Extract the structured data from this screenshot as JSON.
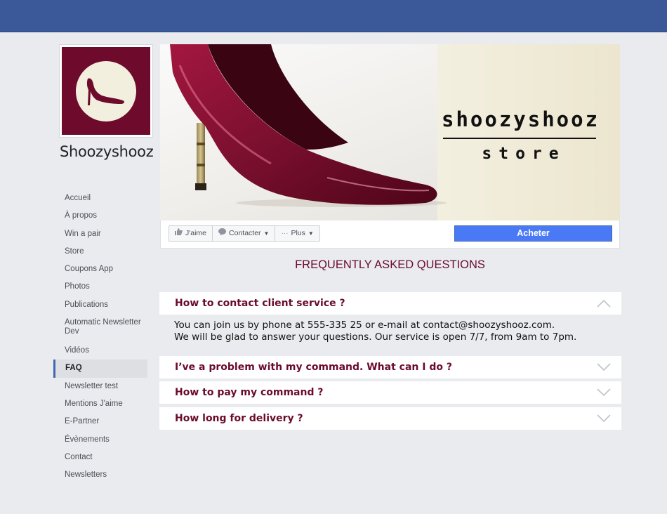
{
  "page": {
    "name": "Shoozyshooz"
  },
  "cover": {
    "brand_title": "shoozyshooz",
    "brand_subtitle": "store"
  },
  "actions": {
    "like": "J'aime",
    "contact": "Contacter",
    "more": "Plus",
    "buy": "Acheter"
  },
  "nav": {
    "items": [
      {
        "label": "Accueil"
      },
      {
        "label": "À propos"
      },
      {
        "label": "Win a pair"
      },
      {
        "label": "Store"
      },
      {
        "label": "Coupons App"
      },
      {
        "label": "Photos"
      },
      {
        "label": "Publications"
      },
      {
        "label": "Automatic Newsletter Dev"
      },
      {
        "label": "Vidéos"
      },
      {
        "label": "FAQ"
      },
      {
        "label": "Newsletter test"
      },
      {
        "label": "Mentions J'aime"
      },
      {
        "label": "E-Partner"
      },
      {
        "label": "Évènements"
      },
      {
        "label": "Contact"
      },
      {
        "label": "Newsletters"
      }
    ],
    "active": "FAQ"
  },
  "faq": {
    "title": "FREQUENTLY ASKED QUESTIONS",
    "items": [
      {
        "question": "How to contact client service ?",
        "answer_line1": "You can join us by phone at 555-335 25 or e-mail at contact@shoozyshooz.com.",
        "answer_line2": "We will be glad to answer your questions. Our service is open 7/7, from 9am to 7pm.",
        "expanded": true
      },
      {
        "question": "I’ve a problem with my command. What can I do ?",
        "expanded": false
      },
      {
        "question": "How to pay my command ?",
        "expanded": false
      },
      {
        "question": "How long for delivery ?",
        "expanded": false
      }
    ]
  },
  "colors": {
    "topbar": "#3b5998",
    "brand": "#6b0b2c",
    "buy_button": "#4a79f5",
    "shoe": "#7a0f2e"
  },
  "icons": {
    "like": "thumbs-up-icon",
    "contact": "chat-bubble-icon",
    "more": "ellipsis-icon",
    "faq_collapse": "chevron-up-icon",
    "faq_expand": "chevron-down-icon"
  }
}
